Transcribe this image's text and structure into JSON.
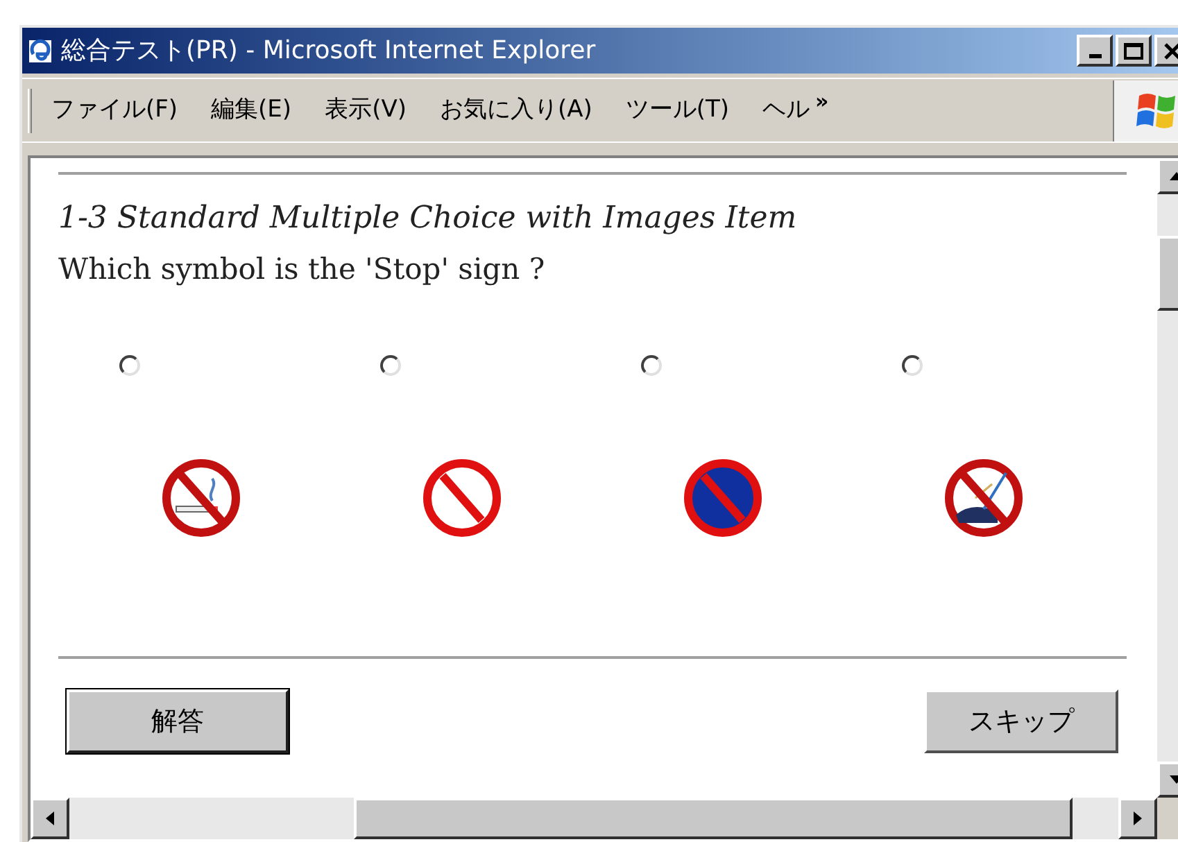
{
  "window": {
    "title": "総合テスト(PR) - Microsoft Internet Explorer"
  },
  "menu": [
    "ファイル(F)",
    "編集(E)",
    "表示(V)",
    "お気に入り(A)",
    "ツール(T)",
    "ヘル"
  ],
  "menu_more": "»",
  "question": {
    "title": "1-3 Standard Multiple Choice with Images Item",
    "prompt": "Which symbol is the 'Stop' sign ?"
  },
  "options": [
    {
      "selected": false,
      "kind": "no-smoking"
    },
    {
      "selected": false,
      "kind": "prohibition"
    },
    {
      "selected": false,
      "kind": "no-parking"
    },
    {
      "selected": false,
      "kind": "no-fishing"
    }
  ],
  "buttons": {
    "answer": "解答",
    "skip": "スキップ"
  }
}
